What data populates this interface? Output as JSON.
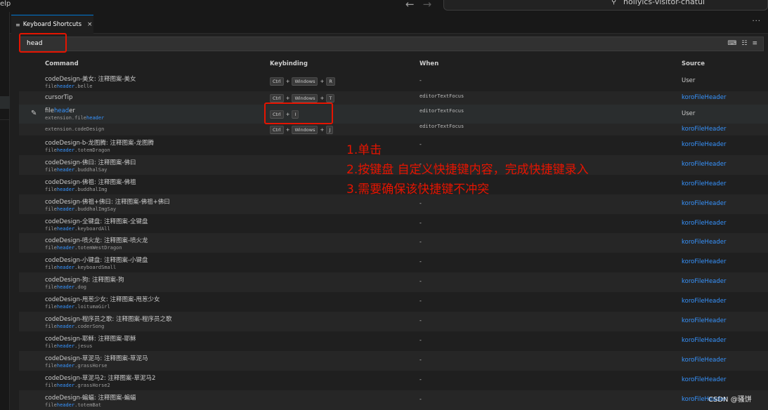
{
  "titlebar": {
    "menu_fragment": "elp",
    "back_icon": "arrow-left-icon",
    "forward_icon": "arrow-right-icon",
    "command_center_text": "hollyics-visitor-chatui"
  },
  "tab": {
    "label": "Keyboard Shortcuts",
    "icon": "keyboard-shortcuts-icon",
    "close": "×"
  },
  "tabbar": {
    "more": "···"
  },
  "search": {
    "value": "head"
  },
  "columns": {
    "command": "Command",
    "keybinding": "Keybinding",
    "when": "When",
    "source": "Source"
  },
  "rows": [
    {
      "title": "codeDesign-美女: 注释图案-美女",
      "id_pre": "file",
      "id_hl": "header",
      "id_post": ".belle",
      "keys": [
        "Ctrl",
        "Windows",
        "R"
      ],
      "when": "-",
      "source": "User"
    },
    {
      "title": "cursorTip",
      "keys": [
        "Ctrl",
        "Windows",
        "T"
      ],
      "when": "editorTextFocus",
      "source": "koroFileHeader"
    },
    {
      "title_pre": "file",
      "title_hl": "head",
      "title_post": "er",
      "id_pre": "extension.file",
      "id_hl": "header",
      "id_post": "",
      "keys": [
        "Ctrl",
        "I"
      ],
      "when": "editorTextFocus",
      "source": "User"
    },
    {
      "id_only": "extension.codeDesign",
      "keys": [
        "Ctrl",
        "Windows",
        "J"
      ],
      "when": "editorTextFocus",
      "source": "koroFileHeader"
    },
    {
      "title": "codeDesign-b-龙图腾: 注释图案-龙图腾",
      "id_pre": "file",
      "id_hl": "header",
      "id_post": ".totemDragon",
      "when": "-",
      "source": "koroFileHeader"
    },
    {
      "title": "codeDesign-佛曰: 注释图案-佛曰",
      "id_pre": "file",
      "id_hl": "header",
      "id_post": ".buddhalSay",
      "when": "-",
      "source": "koroFileHeader"
    },
    {
      "title": "codeDesign-佛祖: 注释图案-佛祖",
      "id_pre": "file",
      "id_hl": "header",
      "id_post": ".buddhalImg",
      "when": "-",
      "source": "koroFileHeader"
    },
    {
      "title": "codeDesign-佛祖+佛曰: 注释图案-佛祖+佛曰",
      "id_pre": "file",
      "id_hl": "header",
      "id_post": ".buddhalImgSay",
      "when": "-",
      "source": "koroFileHeader"
    },
    {
      "title": "codeDesign-全键盘: 注释图案-全键盘",
      "id_pre": "file",
      "id_hl": "header",
      "id_post": ".keyboardAll",
      "when": "-",
      "source": "koroFileHeader"
    },
    {
      "title": "codeDesign-喷火龙: 注释图案-喷火龙",
      "id_pre": "file",
      "id_hl": "header",
      "id_post": ".totemWestDragon",
      "when": "-",
      "source": "koroFileHeader"
    },
    {
      "title": "codeDesign-小键盘: 注释图案-小键盘",
      "id_pre": "file",
      "id_hl": "header",
      "id_post": ".keyboardSmall",
      "when": "-",
      "source": "koroFileHeader"
    },
    {
      "title": "codeDesign-狗: 注释图案-狗",
      "id_pre": "file",
      "id_hl": "header",
      "id_post": ".dog",
      "when": "-",
      "source": "koroFileHeader"
    },
    {
      "title": "codeDesign-甩葱少女: 注释图案-甩葱少女",
      "id_pre": "file",
      "id_hl": "header",
      "id_post": ".loitumaGirl",
      "when": "-",
      "source": "koroFileHeader"
    },
    {
      "title": "codeDesign-程序员之歌: 注释图案-程序员之歌",
      "id_pre": "file",
      "id_hl": "header",
      "id_post": ".coderSong",
      "when": "-",
      "source": "koroFileHeader"
    },
    {
      "title": "codeDesign-耶稣: 注释图案-耶稣",
      "id_pre": "file",
      "id_hl": "header",
      "id_post": ".jesus",
      "when": "-",
      "source": "koroFileHeader"
    },
    {
      "title": "codeDesign-草泥马: 注释图案-草泥马",
      "id_pre": "file",
      "id_hl": "header",
      "id_post": ".grassHorse",
      "when": "-",
      "source": "koroFileHeader"
    },
    {
      "title": "codeDesign-草泥马2: 注释图案-草泥马2",
      "id_pre": "file",
      "id_hl": "header",
      "id_post": ".grassHorse2",
      "when": "-",
      "source": "koroFileHeader"
    },
    {
      "title": "codeDesign-蝙蝠: 注释图案-蝙蝠",
      "id_pre": "file",
      "id_hl": "header",
      "id_post": ".totemBat",
      "when": "-",
      "source": "koroFileHeader"
    }
  ],
  "annotations": [
    "1.单击",
    "2.按键盘 自定义快捷键内容，完成快捷键录入",
    "3.需要确保该快捷键不冲突"
  ],
  "watermark": "CSDN @骚饼",
  "colors": {
    "accent_red": "#e51400",
    "link_blue": "#3794ff",
    "background": "#1f1f1f"
  }
}
